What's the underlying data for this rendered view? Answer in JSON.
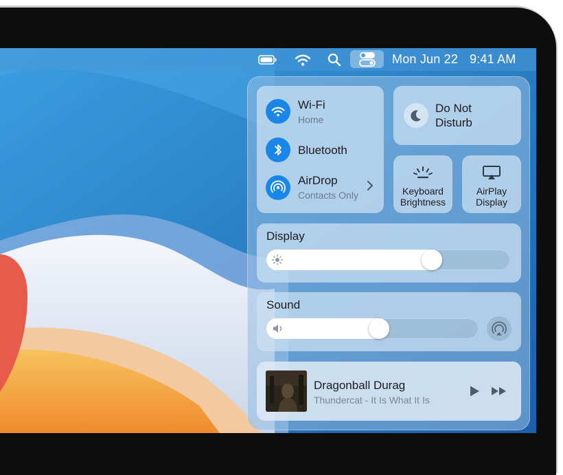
{
  "menubar": {
    "icons": [
      "battery-icon",
      "wifi-icon",
      "search-icon",
      "control-center-icon"
    ],
    "date": "Mon Jun 22",
    "time": "9:41 AM"
  },
  "control_center": {
    "network": {
      "wifi": {
        "label": "Wi-Fi",
        "sub": "Home",
        "icon": "wifi-icon"
      },
      "bluetooth": {
        "label": "Bluetooth",
        "icon": "bluetooth-icon"
      },
      "airdrop": {
        "label": "AirDrop",
        "sub": "Contacts Only",
        "icon": "airdrop-icon"
      }
    },
    "do_not_disturb": {
      "label": "Do Not Disturb",
      "icon": "moon-icon"
    },
    "keyboard_brightness": {
      "label": "Keyboard Brightness",
      "icon": "keyboard-brightness-icon"
    },
    "airplay_display": {
      "label": "AirPlay Display",
      "icon": "airplay-display-icon"
    },
    "display": {
      "label": "Display",
      "level": 0.72,
      "icon": "sun-icon"
    },
    "sound": {
      "label": "Sound",
      "level": 0.58,
      "icon": "speaker-icon",
      "output_icon": "airplay-audio-icon"
    },
    "now_playing": {
      "title": "Dragonball Durag",
      "subtitle": "Thundercat - It Is What It Is",
      "controls": [
        "play-icon",
        "fast-forward-icon"
      ]
    }
  },
  "colors": {
    "accent": "#1a86e8",
    "wallpaper_blue": "#2b7cc6",
    "wallpaper_orange": "#f29a3c",
    "wallpaper_red": "#e85a4c"
  }
}
